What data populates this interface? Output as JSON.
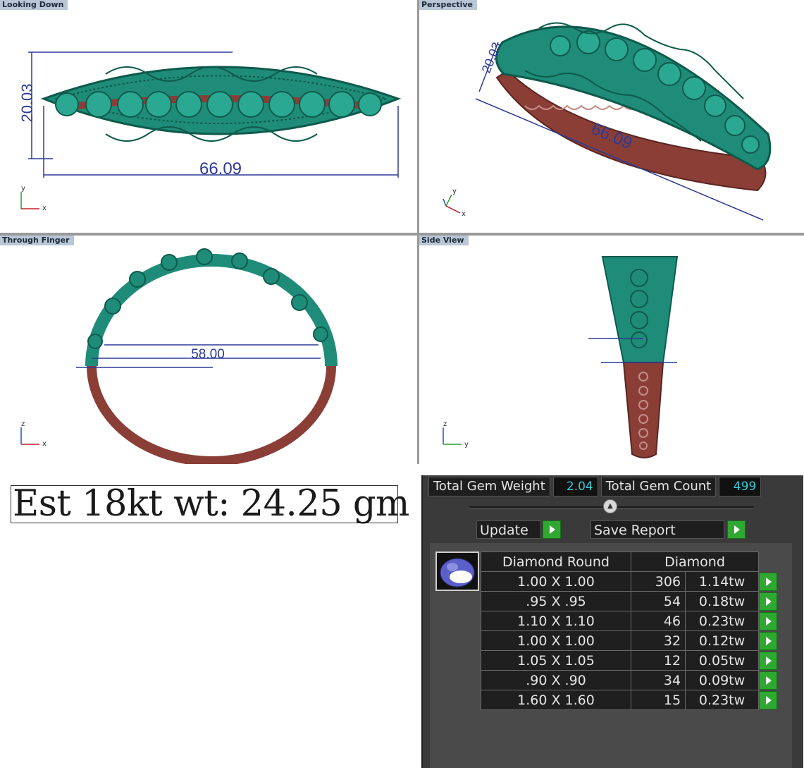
{
  "viewports": {
    "top_left": {
      "title": "Looking Down",
      "dim_height": "20.03",
      "dim_width": "66.09",
      "axis_a": "y",
      "axis_b": "x"
    },
    "top_right": {
      "title": "Perspective",
      "dim_height": "20.03",
      "dim_width": "66.09",
      "axis_a": "y",
      "axis_b": "x"
    },
    "bottom_left": {
      "title": "Through Finger",
      "dim_inner": "58.00",
      "axis_a": "z",
      "axis_b": "x"
    },
    "bottom_right": {
      "title": "Side View",
      "axis_a": "z",
      "axis_b": "y"
    }
  },
  "estimate": {
    "text": "Est 18kt wt: 24.25 gm"
  },
  "gem_panel": {
    "total_weight_label": "Total Gem Weight",
    "total_weight_value": "2.04",
    "total_count_label": "Total Gem Count",
    "total_count_value": "499",
    "update_label": "Update",
    "save_report_label": "Save Report",
    "table": {
      "header_shape": "Diamond Round",
      "header_type": "Diamond",
      "rows": [
        {
          "size": "1.00 X 1.00",
          "count": "306",
          "weight": "1.14tw"
        },
        {
          "size": ".95 X .95",
          "count": "54",
          "weight": "0.18tw"
        },
        {
          "size": "1.10 X 1.10",
          "count": "46",
          "weight": "0.23tw"
        },
        {
          "size": "1.00 X 1.00",
          "count": "32",
          "weight": "0.12tw"
        },
        {
          "size": "1.05 X 1.05",
          "count": "12",
          "weight": "0.05tw"
        },
        {
          "size": ".90 X .90",
          "count": "34",
          "weight": "0.09tw"
        },
        {
          "size": "1.60 X 1.60",
          "count": "15",
          "weight": "0.23tw"
        }
      ]
    }
  },
  "colors": {
    "metal_green": "#1e8c78",
    "metal_green_dark": "#0e5a4c",
    "metal_red": "#8a3e36",
    "dimension_blue": "#2c3a96",
    "play_green": "#2fa832",
    "value_cyan": "#36c9d6"
  }
}
